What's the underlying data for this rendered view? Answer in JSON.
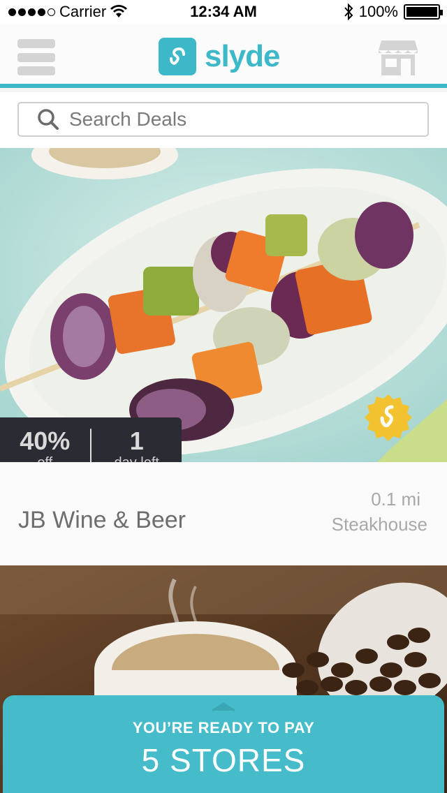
{
  "status_bar": {
    "carrier": "Carrier",
    "time": "12:34 AM",
    "battery": "100%"
  },
  "nav": {
    "logo_text": "slyde",
    "menu_icon": "hamburger-icon",
    "store_icon": "storefront-icon"
  },
  "search": {
    "placeholder": "Search Deals",
    "icon": "search-icon"
  },
  "deals": [
    {
      "discount": "40%",
      "discount_label": "off",
      "days": "1",
      "days_label": "day left",
      "store_name": "JB Wine & Beer",
      "distance": "0.1 mi",
      "category": "Steakhouse"
    }
  ],
  "pay_panel": {
    "title": "YOU’RE READY TO PAY",
    "count_label": "5 STORES"
  },
  "colors": {
    "brand": "#3db8c8",
    "panel": "#46bccb",
    "badge_bg": "#2b2b33",
    "seal": "#f2c230"
  }
}
